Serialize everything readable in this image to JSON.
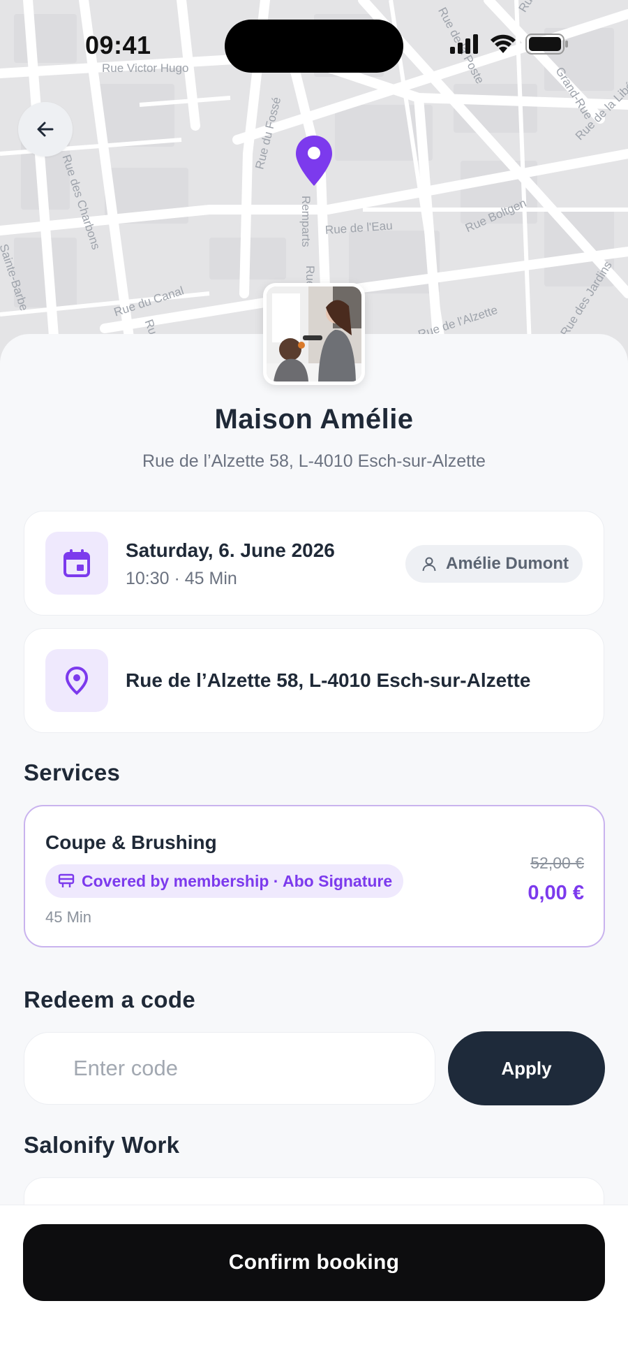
{
  "status_bar": {
    "time": "09:41",
    "icons": [
      "cellular-signal-icon",
      "wifi-icon",
      "battery-icon"
    ]
  },
  "map": {
    "street_labels": [
      "Rue Victor Hugo",
      "Rue du Fossé",
      "Remparts",
      "Rue de l'Eau",
      "Rue Boltgen",
      "Rue des Charbons",
      "Rue du Canal",
      "Sainte-Barbe",
      "Rue des Jardins",
      "Rue",
      "Rue",
      "Rue de la Poste",
      "Grand-Rue",
      "Rue d'Orientale",
      "Rue de l'Alzette",
      "Rue de la Libération"
    ]
  },
  "salon": {
    "name": "Maison Amélie",
    "address": "Rue de l’Alzette 58, L-4010 Esch-sur-Alzette"
  },
  "appointment": {
    "date": "Saturday, 6. June 2026",
    "time_duration": "10:30 · 45 Min",
    "staff": "Amélie Dumont"
  },
  "location": {
    "address": "Rue de l’Alzette 58, L-4010 Esch-sur-Alzette"
  },
  "services": {
    "title": "Services",
    "items": [
      {
        "name": "Coupe & Brushing",
        "membership": "Covered by membership · Abo Signature",
        "duration": "45 Min",
        "old_price": "52,00 €",
        "price": "0,00 €"
      }
    ]
  },
  "redeem": {
    "title": "Redeem a code",
    "placeholder": "Enter code",
    "apply_label": "Apply"
  },
  "work": {
    "title": "Salonify Work"
  },
  "footer": {
    "confirm_label": "Confirm booking"
  },
  "colors": {
    "accent": "#7c3aed",
    "accent_soft": "#efe9fd",
    "dark_button": "#1e2a3a",
    "confirm_button": "#0d0d0f"
  }
}
